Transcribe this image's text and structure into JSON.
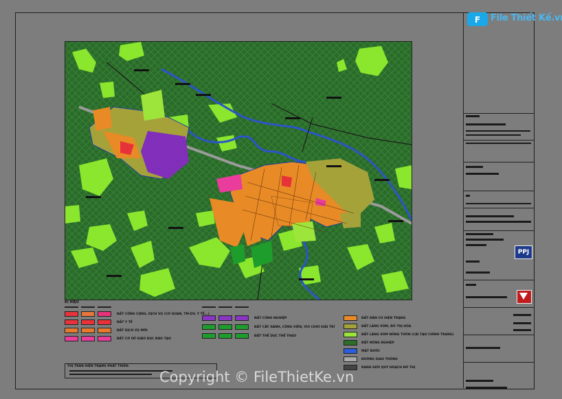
{
  "logo": {
    "text": "File Thiết Kế.vn"
  },
  "legend": {
    "title": "KÍ HIỆU",
    "items_col1": [
      {
        "label": "ĐẤT CÔNG CỘNG, DỊCH VỤ (CƠ QUAN, TM-DV, Y TẾ...)",
        "color": "#e8323a"
      },
      {
        "label": "ĐẤT Y TẾ",
        "color": "#e8323a"
      },
      {
        "label": "ĐẤT DỊCH VỤ MỚI",
        "color": "#e87a30"
      },
      {
        "label": "ĐẤT CƠ SỞ GIÁO DỤC ĐÀO TẠO",
        "color": "#ea3c9c"
      }
    ],
    "items_col2": [
      {
        "label": "ĐẤT CÔNG NGHIỆP",
        "color": "#8a35c4"
      },
      {
        "label": "ĐẤT CÂY XANH, CÔNG VIÊN, VUI CHƠI GIẢI TRÍ",
        "color": "#1f9d2c"
      },
      {
        "label": "ĐẤT THỂ DỤC THỂ THAO",
        "color": "#1f9d2c"
      }
    ],
    "items_col3": [
      {
        "label": "ĐẤT DÂN CƯ HIỆN TRẠNG",
        "color": "#e88a25"
      },
      {
        "label": "ĐẤT LÀNG XÓM, ĐÔ THỊ HÓA",
        "color": "#a6a23a"
      },
      {
        "label": "ĐẤT LÀNG XÓM NÔNG THÔN (CẢI TẠO CHỈNH TRANG)",
        "color": "#9de53a"
      },
      {
        "label": "ĐẤT NÔNG NGHIỆP",
        "color": "#2c6e2c"
      },
      {
        "label": "MẶT NƯỚC",
        "color": "#2a5de0"
      },
      {
        "label": "ĐƯỜNG GIAO THÔNG",
        "color": "#a9a9a9"
      },
      {
        "label": "RANH GIỚI QUY HOẠCH ĐÔ THỊ",
        "color": "#444444"
      }
    ],
    "note_title": "THỊ TRẤN HIỆN TRẠNG PHÁT TRIỂN:"
  },
  "title_block": {
    "ppj": "PPJ"
  },
  "watermark": "Copyright © FileThietKe.vn",
  "colors": {
    "agri": "#2c6e2c",
    "forest": "#8be62e",
    "road": "#9b9b9b",
    "river": "#2b55c8",
    "border": "#1f3fa0"
  }
}
